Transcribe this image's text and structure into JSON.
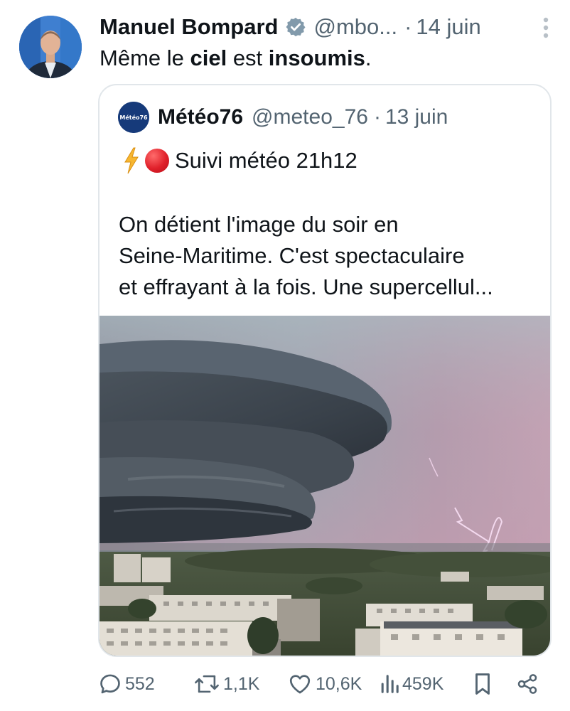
{
  "post": {
    "author_name": "Manuel Bompard",
    "handle": "@mbo...",
    "separator": "·",
    "date": "14 juin",
    "text_parts": [
      "Même le ",
      "ciel",
      " est ",
      "insoumis",
      "."
    ]
  },
  "quote": {
    "author_name": "Météo76",
    "handle": "@meteo_76",
    "separator": "·",
    "date": "13 juin",
    "avatar_text": "Météo76",
    "line1_text": "Suivi météo 21h12",
    "line1_icons": [
      "lightning-emoji",
      "red-circle-emoji"
    ],
    "body_lines": [
      "On détient l'image du soir en",
      "Seine-Maritime. C'est spectaculaire",
      "et effrayant à la fois. Une supercellul..."
    ]
  },
  "actions": {
    "replies": "552",
    "reposts": "1,1K",
    "likes": "10,6K",
    "views": "459K",
    "icons": [
      "reply-icon",
      "repost-icon",
      "like-icon",
      "views-icon",
      "bookmark-icon",
      "share-icon"
    ]
  },
  "colors": {
    "text": "#0f1419",
    "secondary": "#536471",
    "verified": "#829aab",
    "border": "#e1e6ea"
  }
}
